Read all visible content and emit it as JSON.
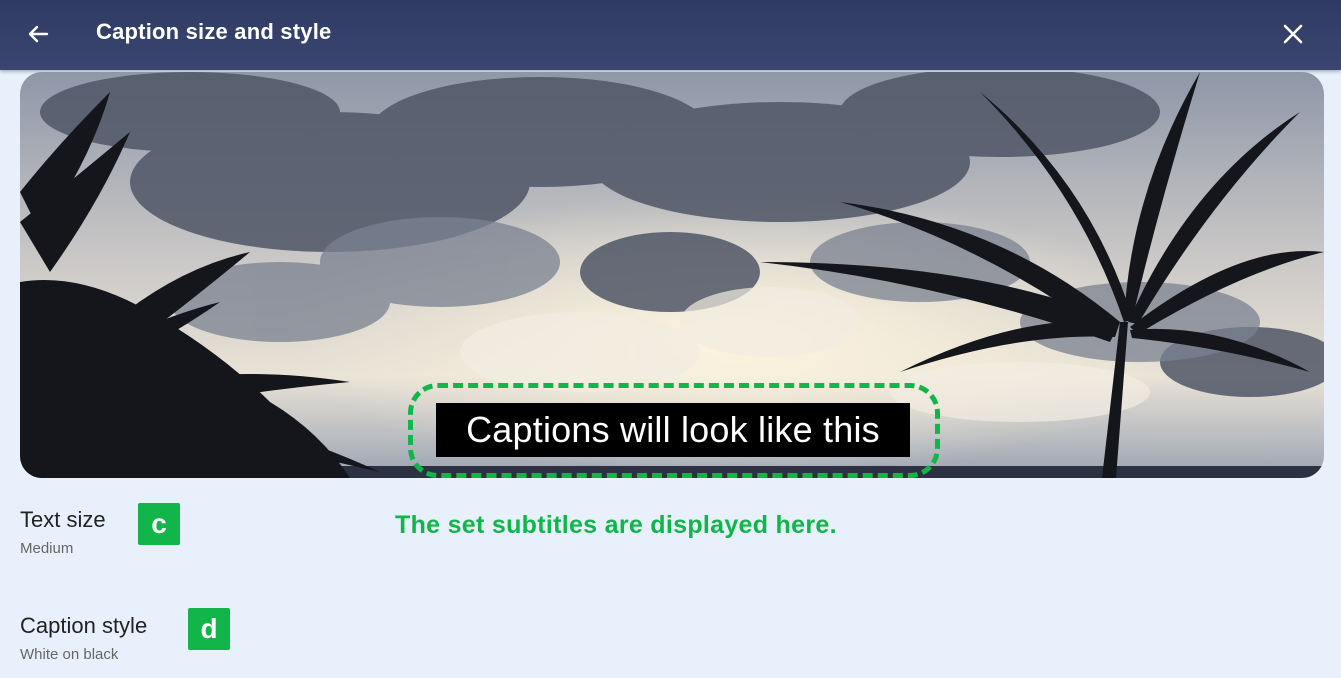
{
  "header": {
    "title": "Caption size and style",
    "back_icon": "arrow-left-icon",
    "close_icon": "close-icon",
    "background_color": "#343f68"
  },
  "preview": {
    "caption_text": "Captions will look like this",
    "image_description": "palm-trees-cloudy-sky"
  },
  "annotation": {
    "note": "The set subtitles are displayed here.",
    "highlight_color": "#12b54a"
  },
  "settings": [
    {
      "label": "Text size",
      "value": "Medium",
      "badge": "c"
    },
    {
      "label": "Caption style",
      "value": "White on black",
      "badge": "d"
    }
  ]
}
